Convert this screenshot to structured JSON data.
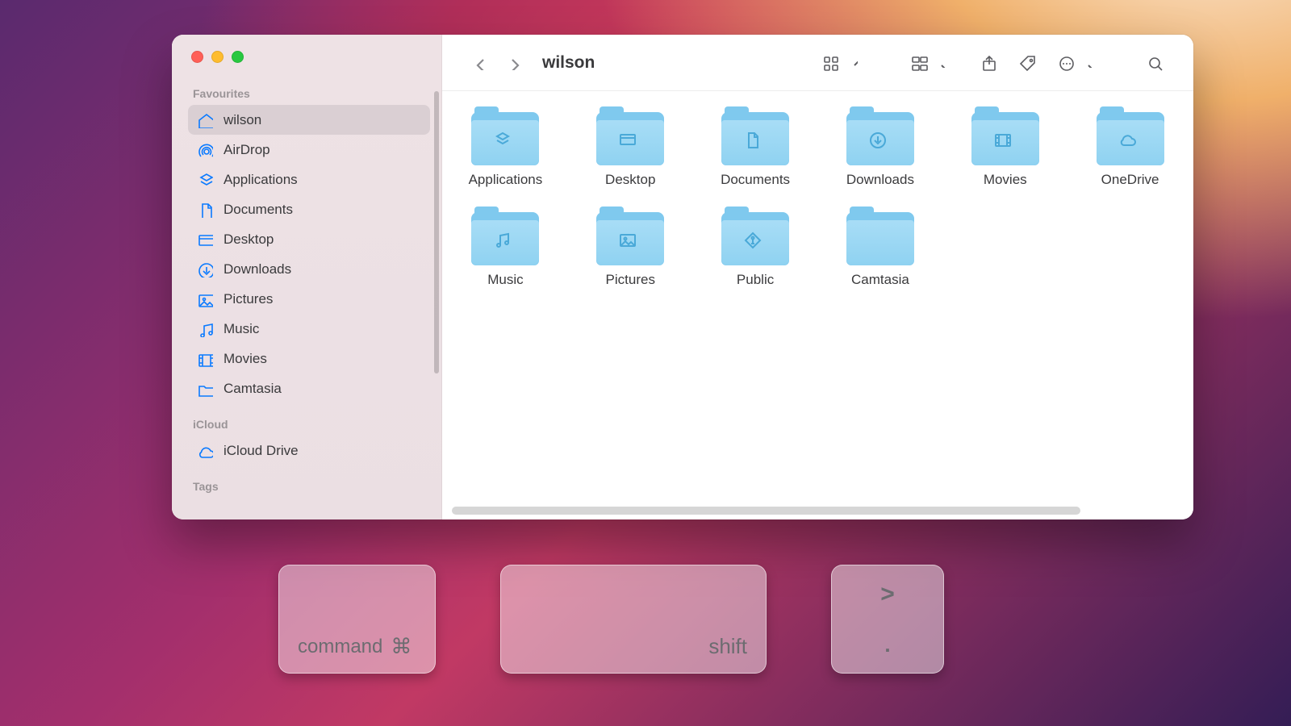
{
  "window": {
    "title": "wilson"
  },
  "sidebar": {
    "sections": {
      "favourites_label": "Favourites",
      "icloud_label": "iCloud",
      "tags_label": "Tags"
    },
    "favourites": [
      {
        "label": "wilson",
        "icon": "home",
        "selected": true
      },
      {
        "label": "AirDrop",
        "icon": "airdrop",
        "selected": false
      },
      {
        "label": "Applications",
        "icon": "apps",
        "selected": false
      },
      {
        "label": "Documents",
        "icon": "doc",
        "selected": false
      },
      {
        "label": "Desktop",
        "icon": "desktop",
        "selected": false
      },
      {
        "label": "Downloads",
        "icon": "download",
        "selected": false
      },
      {
        "label": "Pictures",
        "icon": "pictures",
        "selected": false
      },
      {
        "label": "Music",
        "icon": "music",
        "selected": false
      },
      {
        "label": "Movies",
        "icon": "movies",
        "selected": false
      },
      {
        "label": "Camtasia",
        "icon": "folder",
        "selected": false
      }
    ],
    "icloud": [
      {
        "label": "iCloud Drive",
        "icon": "cloud"
      }
    ]
  },
  "folders": [
    {
      "label": "Applications",
      "glyph": "apps"
    },
    {
      "label": "Desktop",
      "glyph": "desktop"
    },
    {
      "label": "Documents",
      "glyph": "doc"
    },
    {
      "label": "Downloads",
      "glyph": "download"
    },
    {
      "label": "Movies",
      "glyph": "movies"
    },
    {
      "label": "OneDrive",
      "glyph": "cloud"
    },
    {
      "label": "Music",
      "glyph": "music"
    },
    {
      "label": "Pictures",
      "glyph": "pictures"
    },
    {
      "label": "Public",
      "glyph": "public"
    },
    {
      "label": "Camtasia",
      "glyph": "none"
    }
  ],
  "keys": {
    "command": "command",
    "command_symbol": "⌘",
    "shift": "shift",
    "sym_top": ">",
    "sym_bottom": "."
  }
}
